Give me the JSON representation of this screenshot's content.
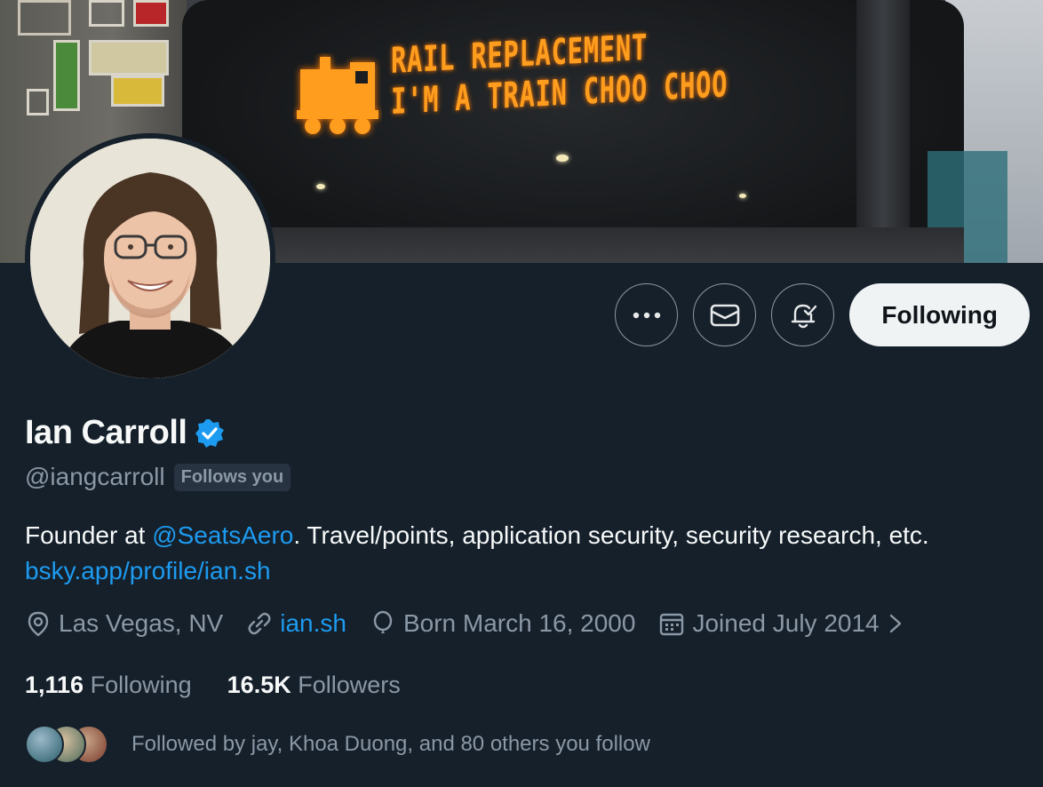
{
  "banner": {
    "sign_line1": "RAIL REPLACEMENT",
    "sign_line2": "I'M A TRAIN CHOO CHOO"
  },
  "actions": {
    "more_icon": "more-horizontal-icon",
    "message_icon": "envelope-icon",
    "notify_icon": "bell-check-icon",
    "follow_label": "Following"
  },
  "profile": {
    "name": "Ian Carroll",
    "verified_icon": "verified-badge-icon",
    "handle": "@iangcarroll",
    "follows_you": "Follows you",
    "bio_prefix": "Founder at ",
    "bio_mention": "@SeatsAero",
    "bio_suffix": ". Travel/points, application security, security research, etc.",
    "bio_link": "bsky.app/profile/ian.sh"
  },
  "meta": {
    "location": "Las Vegas, NV",
    "website": "ian.sh",
    "born": "Born March 16, 2000",
    "joined": "Joined July 2014"
  },
  "stats": {
    "following_count": "1,116",
    "following_label": "Following",
    "followers_count": "16.5K",
    "followers_label": "Followers"
  },
  "followed_by": "Followed by jay, Khoa Duong, and 80 others you follow",
  "colors": {
    "background": "#15202b",
    "accent": "#1d9bf0",
    "muted": "#8b98a5",
    "sign": "#ff9d1e"
  }
}
